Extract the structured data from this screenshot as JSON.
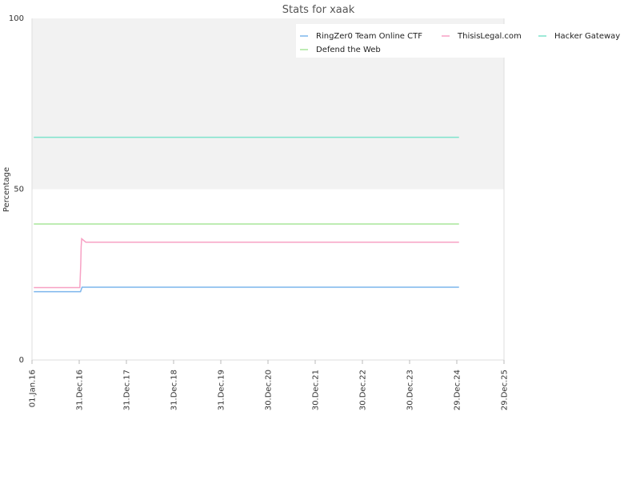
{
  "chart_data": {
    "type": "line",
    "title": "Stats for xaak",
    "xlabel": "",
    "ylabel": "Percentage",
    "ylim": [
      0,
      100
    ],
    "xlim": [
      "2016-01-01",
      "2025-12-29"
    ],
    "y_ticks": [
      0,
      50,
      100
    ],
    "x_ticks": [
      {
        "date": "2016-01-01",
        "label": "01.Jan.16"
      },
      {
        "date": "2016-12-31",
        "label": "31.Dec.16"
      },
      {
        "date": "2017-12-31",
        "label": "31.Dec.17"
      },
      {
        "date": "2018-12-31",
        "label": "31.Dec.18"
      },
      {
        "date": "2019-12-31",
        "label": "31.Dec.19"
      },
      {
        "date": "2020-12-30",
        "label": "30.Dec.20"
      },
      {
        "date": "2021-12-30",
        "label": "30.Dec.21"
      },
      {
        "date": "2022-12-30",
        "label": "30.Dec.22"
      },
      {
        "date": "2023-12-30",
        "label": "30.Dec.23"
      },
      {
        "date": "2024-12-29",
        "label": "29.Dec.24"
      },
      {
        "date": "2025-12-29",
        "label": "29.Dec.25"
      }
    ],
    "background_band": {
      "from": 50,
      "to": 100,
      "color": "#f2f2f2"
    },
    "legend_position": "top-right",
    "grid": false,
    "series": [
      {
        "name": "RingZer0 Team Online CTF",
        "color": "#7cb5ec",
        "points": [
          [
            "2016-01-15",
            20
          ],
          [
            "2017-01-10",
            20
          ],
          [
            "2017-01-22",
            21.3
          ],
          [
            "2025-01-15",
            21.3
          ]
        ]
      },
      {
        "name": "ThisisLegal.com",
        "color": "#f7a1c4",
        "points": [
          [
            "2016-01-15",
            21.2
          ],
          [
            "2017-01-05",
            21.2
          ],
          [
            "2017-01-08",
            24
          ],
          [
            "2017-01-12",
            28
          ],
          [
            "2017-01-15",
            33
          ],
          [
            "2017-01-19",
            35.5
          ],
          [
            "2017-02-20",
            34.5
          ],
          [
            "2025-01-15",
            34.5
          ]
        ]
      },
      {
        "name": "Hacker Gateway",
        "color": "#7ee3cb",
        "points": [
          [
            "2016-01-15",
            65.2
          ],
          [
            "2025-01-15",
            65.2
          ]
        ]
      },
      {
        "name": "Defend the Web",
        "color": "#a8e69a",
        "points": [
          [
            "2016-01-15",
            39.8
          ],
          [
            "2025-01-15",
            39.8
          ]
        ]
      }
    ]
  }
}
